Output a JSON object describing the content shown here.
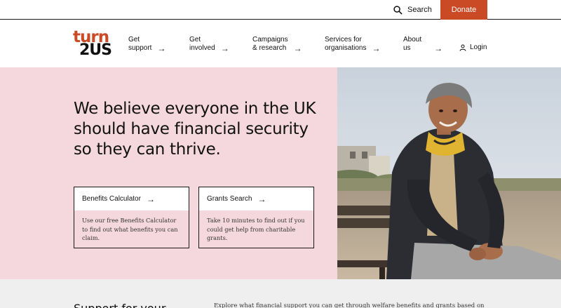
{
  "utility": {
    "search_label": "Search",
    "donate_label": "Donate",
    "donate_color": "#c94a24"
  },
  "logo": {
    "line1": "turn",
    "line2": "2US"
  },
  "nav": {
    "items": [
      {
        "line1": "Get",
        "line2": "support"
      },
      {
        "line1": "Get",
        "line2": "involved"
      },
      {
        "line1": "Campaigns",
        "line2": "& research"
      },
      {
        "line1": "Services for",
        "line2": "organisations"
      },
      {
        "line1": "About",
        "line2": "us"
      }
    ],
    "arrow": "→",
    "login_label": "Login"
  },
  "hero": {
    "title": "We believe everyone in the UK should have financial security so they can thrive.",
    "background": "#f5d8dd",
    "cards": [
      {
        "title": "Benefits Calculator",
        "body": "Use our free Benefits Calculator to find out what benefits you can claim."
      },
      {
        "title": "Grants Search",
        "body": "Take 10 minutes to find out if you could get help from charitable grants."
      }
    ]
  },
  "lower": {
    "title": "Support for your",
    "text": "Explore what financial support you can get through welfare benefits and grants based on"
  }
}
